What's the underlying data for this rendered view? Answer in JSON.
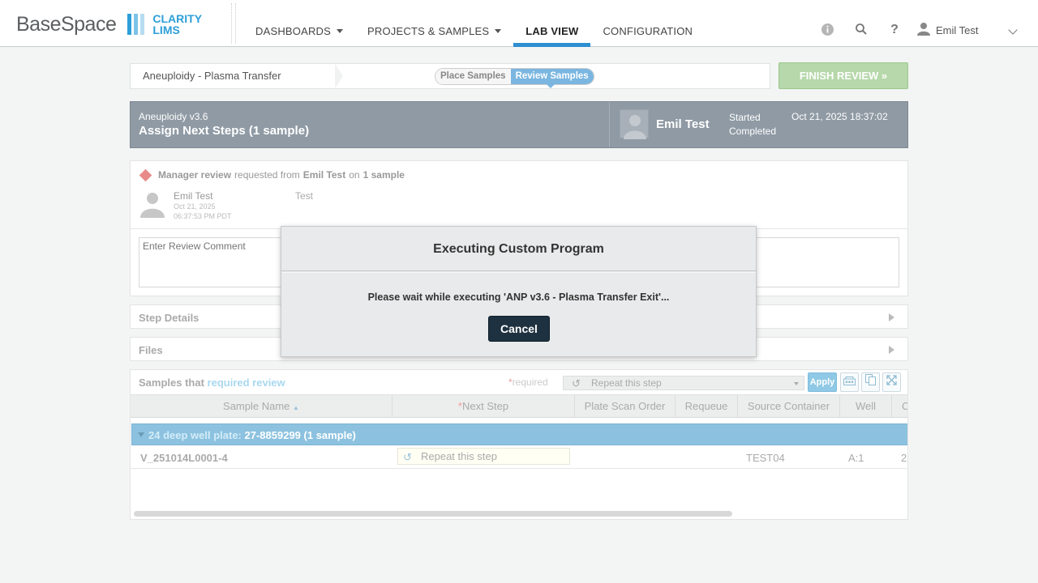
{
  "header": {
    "logo_main": "BaseSpace",
    "logo_product_line1": "CLARITY",
    "logo_product_line2": "LIMS",
    "nav": [
      {
        "label": "DASHBOARDS",
        "has_menu": true
      },
      {
        "label": "PROJECTS & SAMPLES",
        "has_menu": true
      },
      {
        "label": "LAB VIEW",
        "active": true
      },
      {
        "label": "CONFIGURATION"
      }
    ],
    "icons": [
      "info-icon",
      "search-icon",
      "help-icon",
      "user-icon"
    ],
    "user_name": "Emil Test"
  },
  "process": {
    "name": "Aneuploidy - Plasma Transfer",
    "steps": [
      {
        "label": "Place Samples"
      },
      {
        "label": "Review Samples",
        "current": true
      }
    ],
    "finish_label": "FINISH REVIEW »"
  },
  "banner": {
    "protocol": "Aneuploidy v3.6",
    "title": "Assign Next Steps (1 sample)",
    "user": "Emil Test",
    "started_label": "Started",
    "completed_label": "Completed",
    "started_date": "Oct 21, 2025 18:37:02"
  },
  "review": {
    "prefix": "Manager review",
    "mid": "requested from",
    "requester": "Emil Test",
    "on": "on",
    "count": "1 sample",
    "commenter": "Emil Test",
    "date_line1": "Oct 21, 2025",
    "date_line2": "06:37:53 PM PDT",
    "comment": "Test",
    "input_placeholder": "Enter Review Comment"
  },
  "sections": {
    "step_details": "Step Details",
    "files": "Files"
  },
  "samples": {
    "heading_prefix": "Samples that",
    "heading_highlight": "required review",
    "required_star": "*",
    "required_label": "required",
    "next_step_select": "Repeat this step",
    "apply_label": "Apply",
    "columns": [
      {
        "label": "Sample Name",
        "sort": "asc"
      },
      {
        "label": "Next Step",
        "required": true
      },
      {
        "label": "Plate Scan Order"
      },
      {
        "label": "Requeue"
      },
      {
        "label": "Source Container"
      },
      {
        "label": "Well"
      },
      {
        "label": "C"
      }
    ],
    "group": {
      "label": "24 deep well plate:",
      "id": "27-8859299",
      "count": "(1 sample)"
    },
    "rows": [
      {
        "name": "V_251014L0001-4",
        "next_step": "Repeat this step",
        "source": "TEST04",
        "well": "A:1",
        "extra": "2"
      }
    ]
  },
  "modal": {
    "title": "Executing Custom Program",
    "message": "Please wait while executing 'ANP v3.6 - Plasma Transfer Exit'...",
    "cancel_label": "Cancel"
  },
  "colors": {
    "accent": "#2d8fd0",
    "banner": "#8f9aa4",
    "finish": "#b6d8aa",
    "cancel": "#1e3140"
  }
}
